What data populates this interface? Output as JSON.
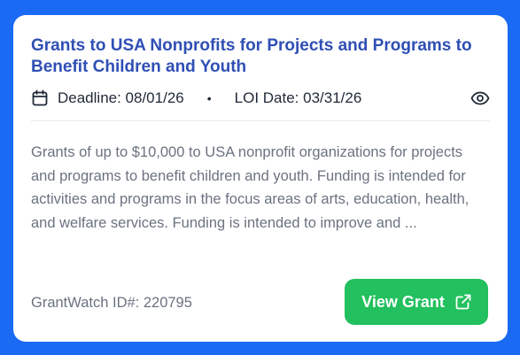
{
  "grant": {
    "title": "Grants to USA Nonprofits for Projects and Programs to Benefit Children and Youth",
    "deadline_label": "Deadline: 08/01/26",
    "separator": "•",
    "loi_label": "LOI Date: 03/31/26",
    "description": "Grants of up to $10,000 to USA nonprofit organizations for projects and programs to benefit children and youth. Funding is intended for activities and programs in the focus areas of arts, education, health, and welfare services. Funding is intended to improve and ...",
    "id_label": "GrantWatch ID#: 220795",
    "button_label": "View Grant"
  },
  "icons": {
    "calendar": "calendar-icon",
    "eye": "eye-icon",
    "external_link": "external-link-icon"
  },
  "colors": {
    "background": "#1a6af4",
    "card": "#ffffff",
    "title": "#2f4fb5",
    "button": "#22c05e",
    "muted_text": "#6b7280"
  }
}
